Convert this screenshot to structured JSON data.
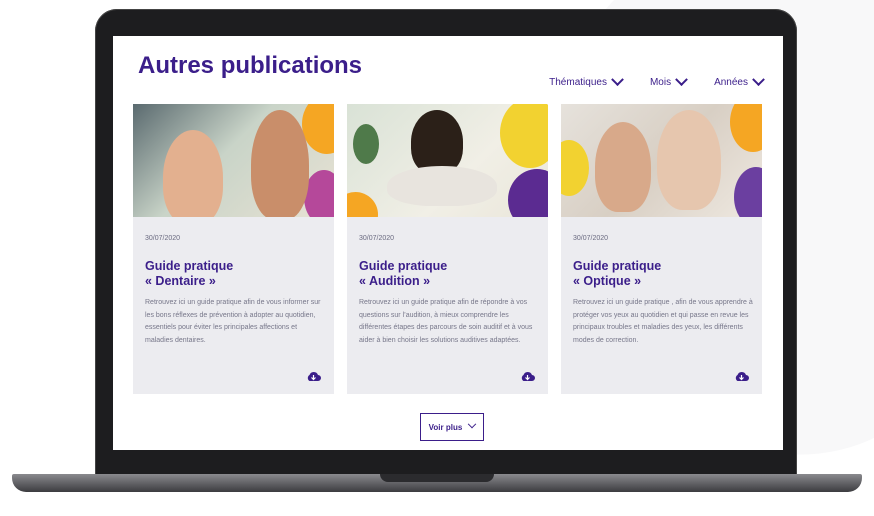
{
  "page": {
    "title": "Autres publications"
  },
  "filters": [
    {
      "label": "Thématiques",
      "icon": "chevron-down-icon"
    },
    {
      "label": "Mois",
      "icon": "chevron-down-icon"
    },
    {
      "label": "Années",
      "icon": "chevron-down-icon"
    }
  ],
  "cards": [
    {
      "date": "30/07/2020",
      "title_line1": "Guide pratique",
      "title_line2": "« Dentaire »",
      "text": "Retrouvez ici un guide pratique afin de vous informer sur les bons réflexes de prévention à adopter au quotidien, essentiels pour éviter les principales affections et maladies dentaires.",
      "download_icon": "cloud-download-icon"
    },
    {
      "date": "30/07/2020",
      "title_line1": "Guide pratique",
      "title_line2": "« Audition »",
      "text": "Retrouvez ici un guide pratique afin de répondre à vos questions sur l’audition, à mieux comprendre les différentes étapes des parcours de soin auditif et à vous aider à bien choisir les solutions auditives adaptées.",
      "download_icon": "cloud-download-icon"
    },
    {
      "date": "30/07/2020",
      "title_line1": "Guide pratique",
      "title_line2": "« Optique »",
      "text": "Retrouvez ici un guide pratique , afin de vous apprendre à protéger vos yeux au quotidien et qui passe en revue les principaux troubles et maladies des yeux, les différents modes de correction.",
      "download_icon": "cloud-download-icon"
    }
  ],
  "more": {
    "label": "Voir plus",
    "icon": "chevron-down-icon"
  },
  "colors": {
    "brand": "#3b1e8a",
    "card_bg": "#ececf0",
    "accent_orange": "#f5a623",
    "accent_purple": "#6b3fa0",
    "accent_yellow": "#f2d230"
  }
}
